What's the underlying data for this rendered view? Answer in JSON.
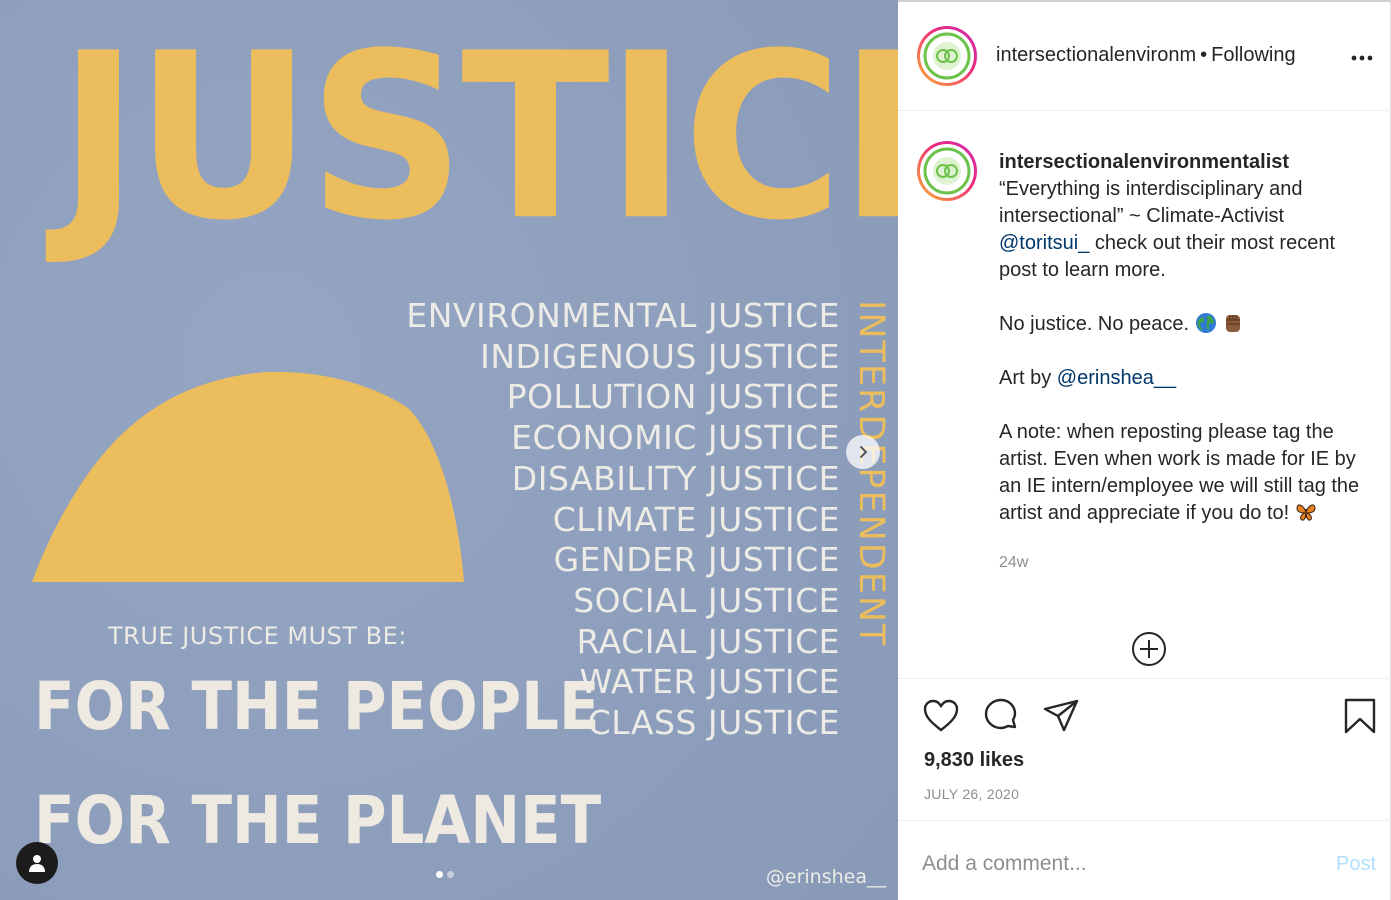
{
  "artwork": {
    "title": "JUSTICE",
    "justice_types": [
      "ENVIRONMENTAL JUSTICE",
      "INDIGENOUS JUSTICE",
      "POLLUTION JUSTICE",
      "ECONOMIC JUSTICE",
      "DISABILITY JUSTICE",
      "CLIMATE JUSTICE",
      "GENDER JUSTICE",
      "SOCIAL JUSTICE",
      "RACIAL JUSTICE",
      "WATER JUSTICE",
      "CLASS JUSTICE"
    ],
    "vertical_word": "INTERDEPENDENT",
    "true_justice_label": "TRUE JUSTICE MUST BE:",
    "slogan_1": "FOR THE PEOPLE",
    "slogan_2": "FOR THE PLANET",
    "watermark": "@erinshea__",
    "colors": {
      "background": "#8ea0bf",
      "yellow": "#ecbd5c",
      "cream": "#ecebe6"
    }
  },
  "carousel": {
    "slide_count": 2,
    "active_index": 0
  },
  "header": {
    "username": "intersectionalenvironm",
    "separator": "•",
    "follow_status": "Following"
  },
  "caption": {
    "username": "intersectionalenvironmentalist",
    "quote_line": "“Everything is interdisciplinary and intersectional” ~ Climate-Activist",
    "mention_1": "@toritsui_",
    "after_mention_1": " check out their most recent post to learn more.",
    "no_justice": "No justice. No peace.",
    "emojis_1": [
      "globe-icon",
      "raised-fist-icon"
    ],
    "art_by_label": "Art by ",
    "mention_2": "@erinshea__",
    "note": "A note: when reposting please tag the artist. Even when work is made for IE by an IE intern/employee we will still tag the artist and appreciate if you do to!",
    "emoji_2": "butterfly-icon",
    "relative_time": "24w"
  },
  "stats": {
    "likes": "9,830 likes",
    "date": "JULY 26, 2020"
  },
  "comment": {
    "placeholder": "Add a comment...",
    "post_label": "Post"
  }
}
